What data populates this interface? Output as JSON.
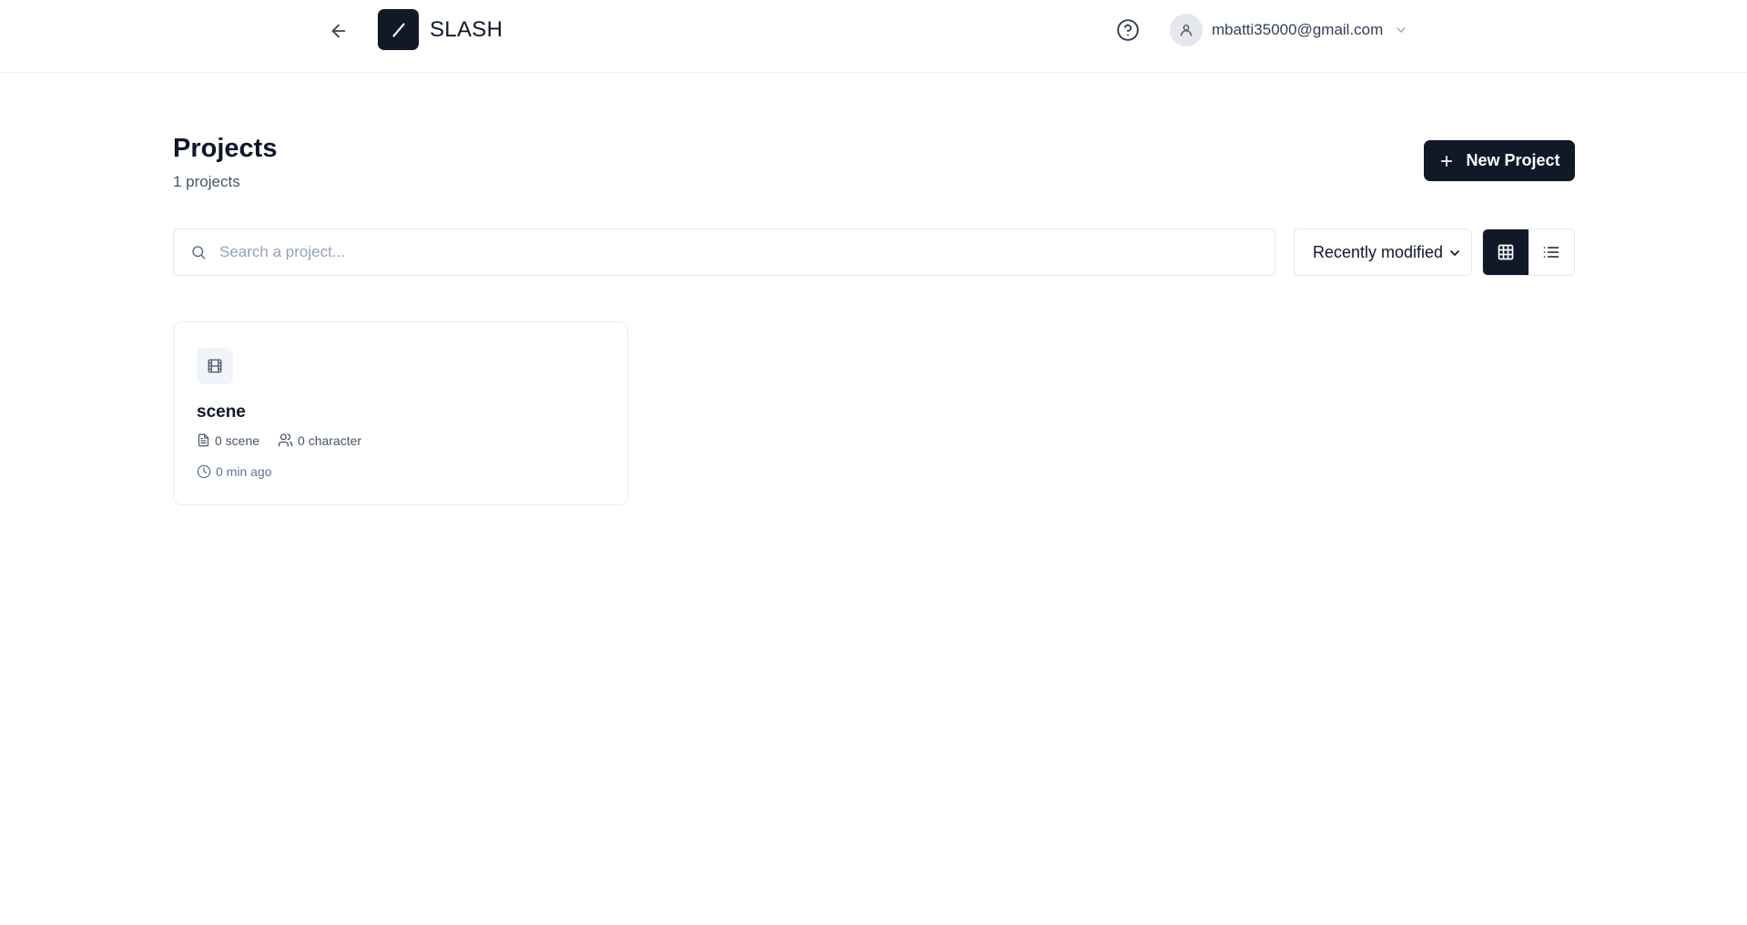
{
  "header": {
    "brand": "SLASH",
    "user_email": "mbatti35000@gmail.com",
    "icons": {
      "back": "arrow-left-icon",
      "logo": "slash-logo-icon",
      "help": "help-circle-icon",
      "avatar": "user-icon",
      "menu": "chevron-down-icon"
    }
  },
  "main": {
    "title": "Projects",
    "count_text": "1 projects",
    "new_project_label": "New Project",
    "search": {
      "placeholder": "Search a project...",
      "value": ""
    },
    "sort": {
      "selected": "Recently modified"
    },
    "view_mode": "grid"
  },
  "projects": [
    {
      "name": "scene",
      "scenes": "0 scene",
      "characters": "0 character",
      "modified": "0 min ago",
      "icon": "film-icon"
    }
  ],
  "colors": {
    "primary": "#111827",
    "text": "#0f172a",
    "muted": "#475569",
    "border": "#e2e8f0"
  }
}
